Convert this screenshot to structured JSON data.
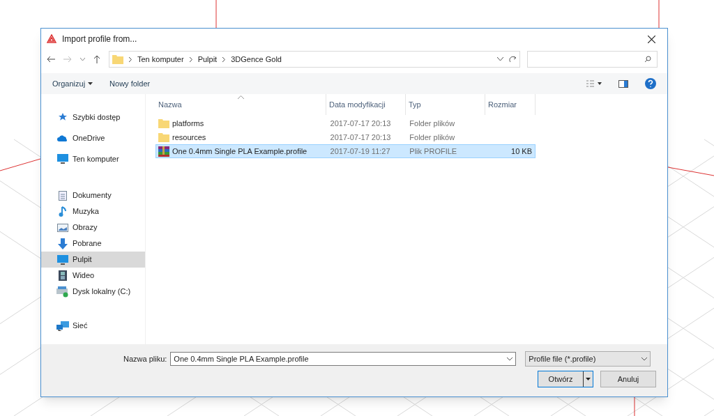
{
  "window": {
    "title": "Import profile from..."
  },
  "address": {
    "crumbs": [
      "Ten komputer",
      "Pulpit",
      "3DGence Gold"
    ]
  },
  "toolbar": {
    "organize": "Organizuj",
    "new_folder": "Nowy folder"
  },
  "sidebar": {
    "groups": [
      [
        {
          "label": "Szybki dostęp",
          "kind": "star",
          "selected": false
        },
        {
          "label": "OneDrive",
          "kind": "cloud",
          "selected": false
        },
        {
          "label": "Ten komputer",
          "kind": "pc",
          "selected": false
        }
      ],
      [
        {
          "label": "Dokumenty",
          "kind": "doc",
          "selected": false
        },
        {
          "label": "Muzyka",
          "kind": "music",
          "selected": false
        },
        {
          "label": "Obrazy",
          "kind": "image",
          "selected": false
        },
        {
          "label": "Pobrane",
          "kind": "download",
          "selected": false
        },
        {
          "label": "Pulpit",
          "kind": "desktop",
          "selected": true
        },
        {
          "label": "Wideo",
          "kind": "video",
          "selected": false
        },
        {
          "label": "Dysk lokalny (C:)",
          "kind": "drive",
          "selected": false
        }
      ],
      [
        {
          "label": "Sieć",
          "kind": "network",
          "selected": false
        }
      ]
    ]
  },
  "table": {
    "columns": [
      "Nazwa",
      "Data modyfikacji",
      "Typ",
      "Rozmiar"
    ],
    "rows": [
      {
        "kind": "folder",
        "name": "platforms",
        "date": "2017-07-17 20:13",
        "type": "Folder plików",
        "selected": false
      },
      {
        "kind": "folder",
        "name": "resources",
        "date": "2017-07-17 20:13",
        "type": "Folder plików",
        "selected": false
      },
      {
        "kind": "archive",
        "name": "One 0.4mm Single PLA Example.profile",
        "date": "2017-07-19 11:27",
        "type": "Plik PROFILE",
        "size": "10 KB",
        "selected": true
      }
    ]
  },
  "footer": {
    "filename_label": "Nazwa pliku:",
    "filename": "One 0.4mm Single PLA Example.profile",
    "filter": "Profile file (*.profile)",
    "open": "Otwórz",
    "cancel": "Anuluj"
  }
}
